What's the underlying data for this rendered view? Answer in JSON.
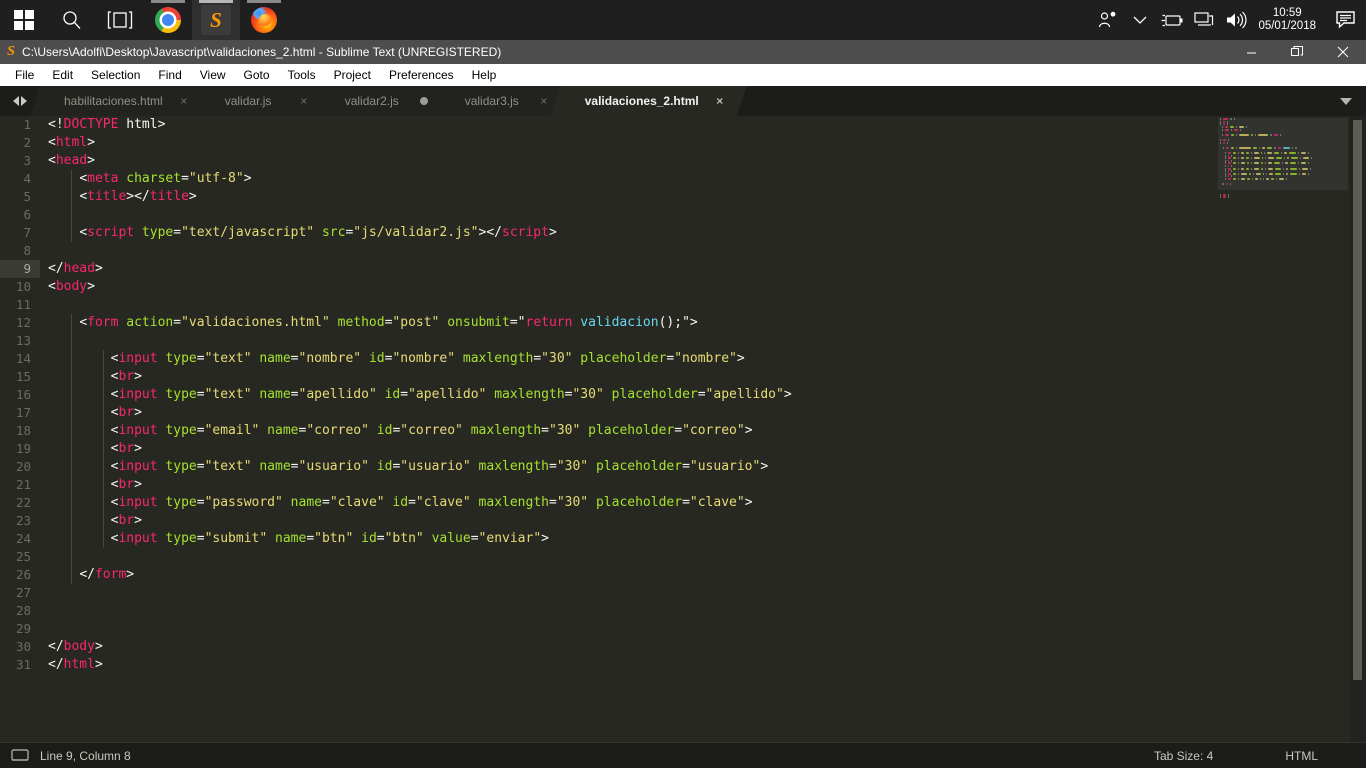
{
  "taskbar": {
    "start": "start-button",
    "search": "search-icon",
    "taskview": "task-view-icon",
    "apps": [
      {
        "name": "chrome",
        "label": "Google Chrome",
        "active": false
      },
      {
        "name": "sublime",
        "label": "Sublime Text",
        "active": true
      },
      {
        "name": "firefox",
        "label": "Mozilla Firefox",
        "active": false
      }
    ],
    "tray": [
      "people-icon",
      "chevron-up-icon",
      "battery-icon",
      "network-icon",
      "volume-icon"
    ],
    "clock": {
      "time": "10:59",
      "date": "05/01/2018"
    },
    "notifications": "action-center-icon"
  },
  "window": {
    "title": "C:\\Users\\Adolfi\\Desktop\\Javascript\\validaciones_2.html - Sublime Text (UNREGISTERED)",
    "controls": {
      "minimize": "—",
      "maximize": "❐",
      "close": "✕"
    }
  },
  "menubar": {
    "items": [
      "File",
      "Edit",
      "Selection",
      "Find",
      "View",
      "Goto",
      "Tools",
      "Project",
      "Preferences",
      "Help"
    ]
  },
  "tabs": {
    "items": [
      {
        "label": "habilitaciones.html",
        "active": false,
        "dirty": false
      },
      {
        "label": "validar.js",
        "active": false,
        "dirty": false
      },
      {
        "label": "validar2.js",
        "active": false,
        "dirty": true
      },
      {
        "label": "validar3.js",
        "active": false,
        "dirty": false
      },
      {
        "label": "validaciones_2.html",
        "active": true,
        "dirty": false
      }
    ],
    "close_glyph": "×"
  },
  "editor": {
    "current_line": 9,
    "total_lines": 31,
    "line_numbers": [
      1,
      2,
      3,
      4,
      5,
      6,
      7,
      8,
      9,
      10,
      11,
      12,
      13,
      14,
      15,
      16,
      17,
      18,
      19,
      20,
      21,
      22,
      23,
      24,
      25,
      26,
      27,
      28,
      29,
      30,
      31
    ],
    "lines": [
      {
        "n": 1,
        "tokens": [
          {
            "c": "t-punc",
            "t": "<!"
          },
          {
            "c": "t-tag",
            "t": "DOCTYPE"
          },
          {
            "c": "t-plain",
            "t": " html"
          },
          {
            "c": "t-punc",
            "t": ">"
          }
        ]
      },
      {
        "n": 2,
        "tokens": [
          {
            "c": "t-punc",
            "t": "<"
          },
          {
            "c": "t-tag",
            "t": "html"
          },
          {
            "c": "t-punc",
            "t": ">"
          }
        ]
      },
      {
        "n": 3,
        "tokens": [
          {
            "c": "t-punc",
            "t": "<"
          },
          {
            "c": "t-tag",
            "t": "head"
          },
          {
            "c": "t-punc",
            "t": ">"
          }
        ]
      },
      {
        "n": 4,
        "tokens": [
          {
            "c": "t-plain",
            "t": "    "
          },
          {
            "c": "t-punc",
            "t": "<"
          },
          {
            "c": "t-tag",
            "t": "meta"
          },
          {
            "c": "t-attr",
            "t": " charset"
          },
          {
            "c": "t-punc",
            "t": "="
          },
          {
            "c": "t-str",
            "t": "\"utf-8\""
          },
          {
            "c": "t-punc",
            "t": ">"
          }
        ]
      },
      {
        "n": 5,
        "tokens": [
          {
            "c": "t-plain",
            "t": "    "
          },
          {
            "c": "t-punc",
            "t": "<"
          },
          {
            "c": "t-tag",
            "t": "title"
          },
          {
            "c": "t-punc",
            "t": "></"
          },
          {
            "c": "t-tag",
            "t": "title"
          },
          {
            "c": "t-punc",
            "t": ">"
          }
        ]
      },
      {
        "n": 6,
        "tokens": []
      },
      {
        "n": 7,
        "tokens": [
          {
            "c": "t-plain",
            "t": "    "
          },
          {
            "c": "t-punc",
            "t": "<"
          },
          {
            "c": "t-tag",
            "t": "script"
          },
          {
            "c": "t-attr",
            "t": " type"
          },
          {
            "c": "t-punc",
            "t": "="
          },
          {
            "c": "t-str",
            "t": "\"text/javascript\""
          },
          {
            "c": "t-attr",
            "t": " src"
          },
          {
            "c": "t-punc",
            "t": "="
          },
          {
            "c": "t-str",
            "t": "\"js/validar2.js\""
          },
          {
            "c": "t-punc",
            "t": "></"
          },
          {
            "c": "t-tag",
            "t": "script"
          },
          {
            "c": "t-punc",
            "t": ">"
          }
        ]
      },
      {
        "n": 8,
        "tokens": []
      },
      {
        "n": 9,
        "tokens": [
          {
            "c": "t-punc",
            "t": "</"
          },
          {
            "c": "t-tag",
            "t": "head"
          },
          {
            "c": "t-punc",
            "t": ">"
          }
        ]
      },
      {
        "n": 10,
        "tokens": [
          {
            "c": "t-punc",
            "t": "<"
          },
          {
            "c": "t-tag",
            "t": "body"
          },
          {
            "c": "t-punc",
            "t": ">"
          }
        ]
      },
      {
        "n": 11,
        "tokens": []
      },
      {
        "n": 12,
        "tokens": [
          {
            "c": "t-plain",
            "t": "    "
          },
          {
            "c": "t-punc",
            "t": "<"
          },
          {
            "c": "t-tag",
            "t": "form"
          },
          {
            "c": "t-attr",
            "t": " action"
          },
          {
            "c": "t-punc",
            "t": "="
          },
          {
            "c": "t-str",
            "t": "\"validaciones.html\""
          },
          {
            "c": "t-attr",
            "t": " method"
          },
          {
            "c": "t-punc",
            "t": "="
          },
          {
            "c": "t-str",
            "t": "\"post\""
          },
          {
            "c": "t-attr",
            "t": " onsubmit"
          },
          {
            "c": "t-punc",
            "t": "=\""
          },
          {
            "c": "t-kw",
            "t": "return"
          },
          {
            "c": "t-plain",
            "t": " "
          },
          {
            "c": "t-fn",
            "t": "validacion"
          },
          {
            "c": "t-plain",
            "t": "();"
          },
          {
            "c": "t-punc",
            "t": "\">"
          }
        ]
      },
      {
        "n": 13,
        "tokens": []
      },
      {
        "n": 14,
        "tokens": [
          {
            "c": "t-plain",
            "t": "        "
          },
          {
            "c": "t-punc",
            "t": "<"
          },
          {
            "c": "t-tag",
            "t": "input"
          },
          {
            "c": "t-attr",
            "t": " type"
          },
          {
            "c": "t-punc",
            "t": "="
          },
          {
            "c": "t-str",
            "t": "\"text\""
          },
          {
            "c": "t-attr",
            "t": " name"
          },
          {
            "c": "t-punc",
            "t": "="
          },
          {
            "c": "t-str",
            "t": "\"nombre\""
          },
          {
            "c": "t-attr",
            "t": " id"
          },
          {
            "c": "t-punc",
            "t": "="
          },
          {
            "c": "t-str",
            "t": "\"nombre\""
          },
          {
            "c": "t-attr",
            "t": " maxlength"
          },
          {
            "c": "t-punc",
            "t": "="
          },
          {
            "c": "t-str",
            "t": "\"30\""
          },
          {
            "c": "t-attr",
            "t": " placeholder"
          },
          {
            "c": "t-punc",
            "t": "="
          },
          {
            "c": "t-str",
            "t": "\"nombre\""
          },
          {
            "c": "t-punc",
            "t": ">"
          }
        ]
      },
      {
        "n": 15,
        "tokens": [
          {
            "c": "t-plain",
            "t": "        "
          },
          {
            "c": "t-punc",
            "t": "<"
          },
          {
            "c": "t-tag",
            "t": "br"
          },
          {
            "c": "t-punc",
            "t": ">"
          }
        ]
      },
      {
        "n": 16,
        "tokens": [
          {
            "c": "t-plain",
            "t": "        "
          },
          {
            "c": "t-punc",
            "t": "<"
          },
          {
            "c": "t-tag",
            "t": "input"
          },
          {
            "c": "t-attr",
            "t": " type"
          },
          {
            "c": "t-punc",
            "t": "="
          },
          {
            "c": "t-str",
            "t": "\"text\""
          },
          {
            "c": "t-attr",
            "t": " name"
          },
          {
            "c": "t-punc",
            "t": "="
          },
          {
            "c": "t-str",
            "t": "\"apellido\""
          },
          {
            "c": "t-attr",
            "t": " id"
          },
          {
            "c": "t-punc",
            "t": "="
          },
          {
            "c": "t-str",
            "t": "\"apellido\""
          },
          {
            "c": "t-attr",
            "t": " maxlength"
          },
          {
            "c": "t-punc",
            "t": "="
          },
          {
            "c": "t-str",
            "t": "\"30\""
          },
          {
            "c": "t-attr",
            "t": " placeholder"
          },
          {
            "c": "t-punc",
            "t": "="
          },
          {
            "c": "t-str",
            "t": "\"apellido\""
          },
          {
            "c": "t-punc",
            "t": ">"
          }
        ]
      },
      {
        "n": 17,
        "tokens": [
          {
            "c": "t-plain",
            "t": "        "
          },
          {
            "c": "t-punc",
            "t": "<"
          },
          {
            "c": "t-tag",
            "t": "br"
          },
          {
            "c": "t-punc",
            "t": ">"
          }
        ]
      },
      {
        "n": 18,
        "tokens": [
          {
            "c": "t-plain",
            "t": "        "
          },
          {
            "c": "t-punc",
            "t": "<"
          },
          {
            "c": "t-tag",
            "t": "input"
          },
          {
            "c": "t-attr",
            "t": " type"
          },
          {
            "c": "t-punc",
            "t": "="
          },
          {
            "c": "t-str",
            "t": "\"email\""
          },
          {
            "c": "t-attr",
            "t": " name"
          },
          {
            "c": "t-punc",
            "t": "="
          },
          {
            "c": "t-str",
            "t": "\"correo\""
          },
          {
            "c": "t-attr",
            "t": " id"
          },
          {
            "c": "t-punc",
            "t": "="
          },
          {
            "c": "t-str",
            "t": "\"correo\""
          },
          {
            "c": "t-attr",
            "t": " maxlength"
          },
          {
            "c": "t-punc",
            "t": "="
          },
          {
            "c": "t-str",
            "t": "\"30\""
          },
          {
            "c": "t-attr",
            "t": " placeholder"
          },
          {
            "c": "t-punc",
            "t": "="
          },
          {
            "c": "t-str",
            "t": "\"correo\""
          },
          {
            "c": "t-punc",
            "t": ">"
          }
        ]
      },
      {
        "n": 19,
        "tokens": [
          {
            "c": "t-plain",
            "t": "        "
          },
          {
            "c": "t-punc",
            "t": "<"
          },
          {
            "c": "t-tag",
            "t": "br"
          },
          {
            "c": "t-punc",
            "t": ">"
          }
        ]
      },
      {
        "n": 20,
        "tokens": [
          {
            "c": "t-plain",
            "t": "        "
          },
          {
            "c": "t-punc",
            "t": "<"
          },
          {
            "c": "t-tag",
            "t": "input"
          },
          {
            "c": "t-attr",
            "t": " type"
          },
          {
            "c": "t-punc",
            "t": "="
          },
          {
            "c": "t-str",
            "t": "\"text\""
          },
          {
            "c": "t-attr",
            "t": " name"
          },
          {
            "c": "t-punc",
            "t": "="
          },
          {
            "c": "t-str",
            "t": "\"usuario\""
          },
          {
            "c": "t-attr",
            "t": " id"
          },
          {
            "c": "t-punc",
            "t": "="
          },
          {
            "c": "t-str",
            "t": "\"usuario\""
          },
          {
            "c": "t-attr",
            "t": " maxlength"
          },
          {
            "c": "t-punc",
            "t": "="
          },
          {
            "c": "t-str",
            "t": "\"30\""
          },
          {
            "c": "t-attr",
            "t": " placeholder"
          },
          {
            "c": "t-punc",
            "t": "="
          },
          {
            "c": "t-str",
            "t": "\"usuario\""
          },
          {
            "c": "t-punc",
            "t": ">"
          }
        ]
      },
      {
        "n": 21,
        "tokens": [
          {
            "c": "t-plain",
            "t": "        "
          },
          {
            "c": "t-punc",
            "t": "<"
          },
          {
            "c": "t-tag",
            "t": "br"
          },
          {
            "c": "t-punc",
            "t": ">"
          }
        ]
      },
      {
        "n": 22,
        "tokens": [
          {
            "c": "t-plain",
            "t": "        "
          },
          {
            "c": "t-punc",
            "t": "<"
          },
          {
            "c": "t-tag",
            "t": "input"
          },
          {
            "c": "t-attr",
            "t": " type"
          },
          {
            "c": "t-punc",
            "t": "="
          },
          {
            "c": "t-str",
            "t": "\"password\""
          },
          {
            "c": "t-attr",
            "t": " name"
          },
          {
            "c": "t-punc",
            "t": "="
          },
          {
            "c": "t-str",
            "t": "\"clave\""
          },
          {
            "c": "t-attr",
            "t": " id"
          },
          {
            "c": "t-punc",
            "t": "="
          },
          {
            "c": "t-str",
            "t": "\"clave\""
          },
          {
            "c": "t-attr",
            "t": " maxlength"
          },
          {
            "c": "t-punc",
            "t": "="
          },
          {
            "c": "t-str",
            "t": "\"30\""
          },
          {
            "c": "t-attr",
            "t": " placeholder"
          },
          {
            "c": "t-punc",
            "t": "="
          },
          {
            "c": "t-str",
            "t": "\"clave\""
          },
          {
            "c": "t-punc",
            "t": ">"
          }
        ]
      },
      {
        "n": 23,
        "tokens": [
          {
            "c": "t-plain",
            "t": "        "
          },
          {
            "c": "t-punc",
            "t": "<"
          },
          {
            "c": "t-tag",
            "t": "br"
          },
          {
            "c": "t-punc",
            "t": ">"
          }
        ]
      },
      {
        "n": 24,
        "tokens": [
          {
            "c": "t-plain",
            "t": "        "
          },
          {
            "c": "t-punc",
            "t": "<"
          },
          {
            "c": "t-tag",
            "t": "input"
          },
          {
            "c": "t-attr",
            "t": " type"
          },
          {
            "c": "t-punc",
            "t": "="
          },
          {
            "c": "t-str",
            "t": "\"submit\""
          },
          {
            "c": "t-attr",
            "t": " name"
          },
          {
            "c": "t-punc",
            "t": "="
          },
          {
            "c": "t-str",
            "t": "\"btn\""
          },
          {
            "c": "t-attr",
            "t": " id"
          },
          {
            "c": "t-punc",
            "t": "="
          },
          {
            "c": "t-str",
            "t": "\"btn\""
          },
          {
            "c": "t-attr",
            "t": " value"
          },
          {
            "c": "t-punc",
            "t": "="
          },
          {
            "c": "t-str",
            "t": "\"enviar\""
          },
          {
            "c": "t-punc",
            "t": ">"
          }
        ]
      },
      {
        "n": 25,
        "tokens": []
      },
      {
        "n": 26,
        "tokens": [
          {
            "c": "t-plain",
            "t": "    "
          },
          {
            "c": "t-punc",
            "t": "</"
          },
          {
            "c": "t-tag",
            "t": "form"
          },
          {
            "c": "t-punc",
            "t": ">"
          }
        ]
      },
      {
        "n": 27,
        "tokens": []
      },
      {
        "n": 28,
        "tokens": []
      },
      {
        "n": 29,
        "tokens": []
      },
      {
        "n": 30,
        "tokens": [
          {
            "c": "t-punc",
            "t": "</"
          },
          {
            "c": "t-tag",
            "t": "body"
          },
          {
            "c": "t-punc",
            "t": ">"
          }
        ]
      },
      {
        "n": 31,
        "tokens": [
          {
            "c": "t-punc",
            "t": "</"
          },
          {
            "c": "t-tag",
            "t": "html"
          },
          {
            "c": "t-punc",
            "t": ">"
          }
        ]
      }
    ]
  },
  "statusbar": {
    "caret": "Line 9, Column 8",
    "tab_size": "Tab Size: 4",
    "syntax": "HTML"
  },
  "colors": {
    "editor_bg": "#272822",
    "tag": "#f92672",
    "attr": "#a6e22e",
    "string": "#e6db74",
    "function": "#66d9ef",
    "plain": "#f8f8f2",
    "titlebar": "#4d4d4d",
    "taskbar": "#1f1f1f"
  }
}
